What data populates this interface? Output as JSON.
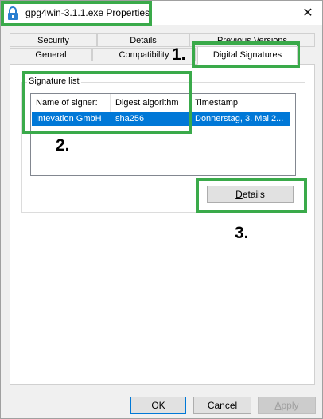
{
  "window": {
    "title": "gpg4win-3.1.1.exe Properties",
    "close_glyph": "✕"
  },
  "tabs": {
    "back_row": [
      "Security",
      "Details",
      "Previous Versions"
    ],
    "front_row": [
      "General",
      "Compatibility",
      "Digital Signatures"
    ],
    "active": "Digital Signatures"
  },
  "signature_list": {
    "label": "Signature list",
    "columns": [
      "Name of signer:",
      "Digest algorithm",
      "Timestamp"
    ],
    "rows": [
      {
        "signer": "Intevation GmbH",
        "digest": "sha256",
        "timestamp": "Donnerstag, 3. Mai 2..."
      }
    ],
    "selected_row_color": "#0078d7"
  },
  "details_button": {
    "label_first": "D",
    "label_rest": "etails"
  },
  "footer": {
    "ok": "OK",
    "cancel": "Cancel",
    "apply_first": "A",
    "apply_rest": "pply"
  },
  "annotations": {
    "color": "#3aaa4a",
    "labels": [
      "1.",
      "2.",
      "3."
    ]
  }
}
